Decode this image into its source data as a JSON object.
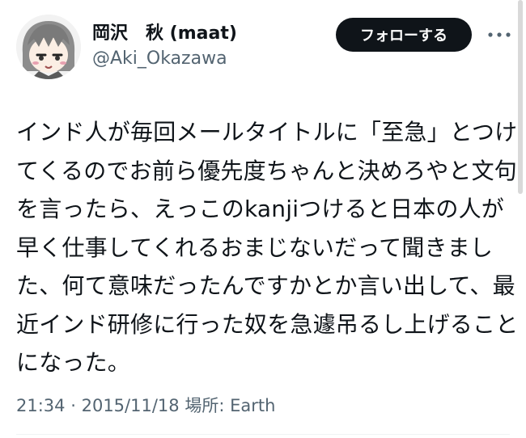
{
  "author": {
    "display_name": "岡沢　秋 (maat)",
    "handle": "@Aki_Okazawa",
    "avatar_icon": "anime-character-avatar"
  },
  "actions": {
    "follow_label": "フォローする",
    "more_icon": "more-dots-icon"
  },
  "tweet": {
    "lines": [
      "インド人が毎回メールタイトルに「至急」とつけ",
      "てくるのでお前ら優先度ちゃんと決めろやと文句",
      "を言ったら、えっこのkanjiつけると日本の人が",
      "早く仕事してくれるおまじないだって聞きまし",
      "た、何て意味だったんですかとか言い出して、最",
      "近インド研修に行った奴を急遽吊るし上げること",
      "になった。"
    ]
  },
  "meta": {
    "time": "21:34",
    "separator": "·",
    "date": "2015/11/18",
    "location_label": "場所:",
    "location": "Earth"
  },
  "colors": {
    "text_primary": "#0f1419",
    "text_secondary": "#536471",
    "button_bg": "#0f1419",
    "button_text": "#ffffff",
    "divider": "#eff3f4"
  }
}
